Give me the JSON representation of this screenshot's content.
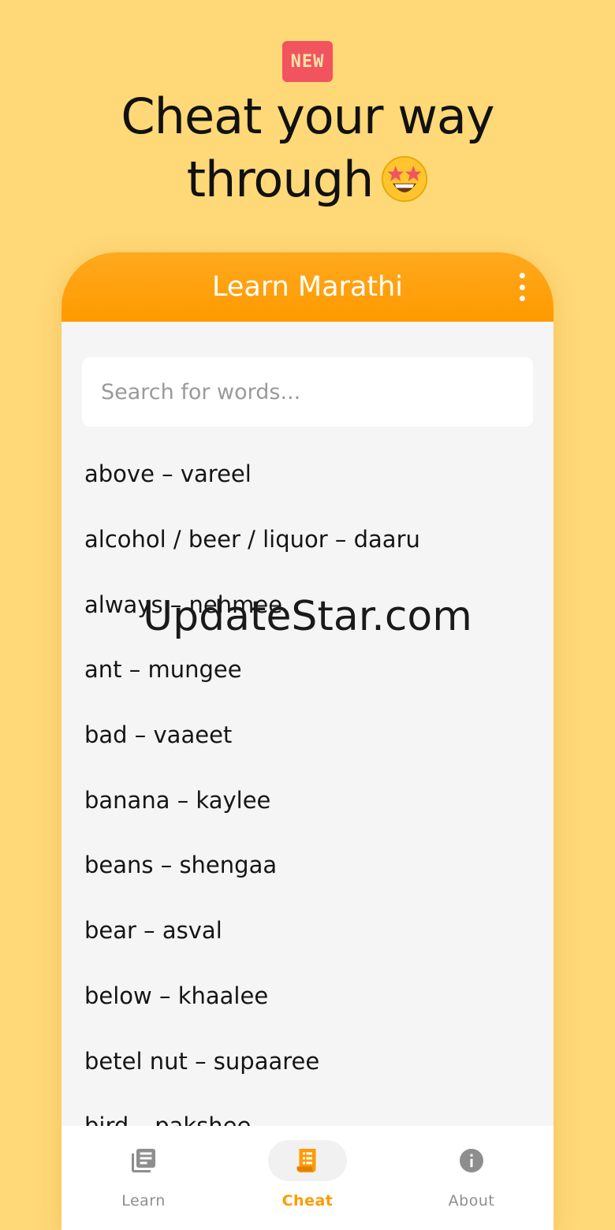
{
  "promo": {
    "badge": "NEW",
    "headline_line1": "Cheat your way",
    "headline_line2": "through",
    "emoji_icon": "star-struck-emoji-icon"
  },
  "app": {
    "title": "Learn Marathi",
    "menu_icon": "more-vert-icon",
    "search_placeholder": "Search for words...",
    "words": [
      "above – vareel",
      "alcohol / beer / liquor – daaru",
      "always – nehmee",
      "ant – mungee",
      "bad – vaaeet",
      "banana – kaylee",
      "beans – shengaa",
      "bear – asval",
      "below – khaalee",
      "betel nut – supaaree",
      "bird – pakshee"
    ],
    "nav": [
      {
        "label": "Learn",
        "icon": "library-books-icon",
        "active": false
      },
      {
        "label": "Cheat",
        "icon": "cheat-sheet-icon",
        "active": true
      },
      {
        "label": "About",
        "icon": "info-icon",
        "active": false
      }
    ]
  },
  "watermark": "UpdateStar.com",
  "colors": {
    "background": "#FFD878",
    "accent": "#FF9A00",
    "badge": "#F2545F"
  }
}
